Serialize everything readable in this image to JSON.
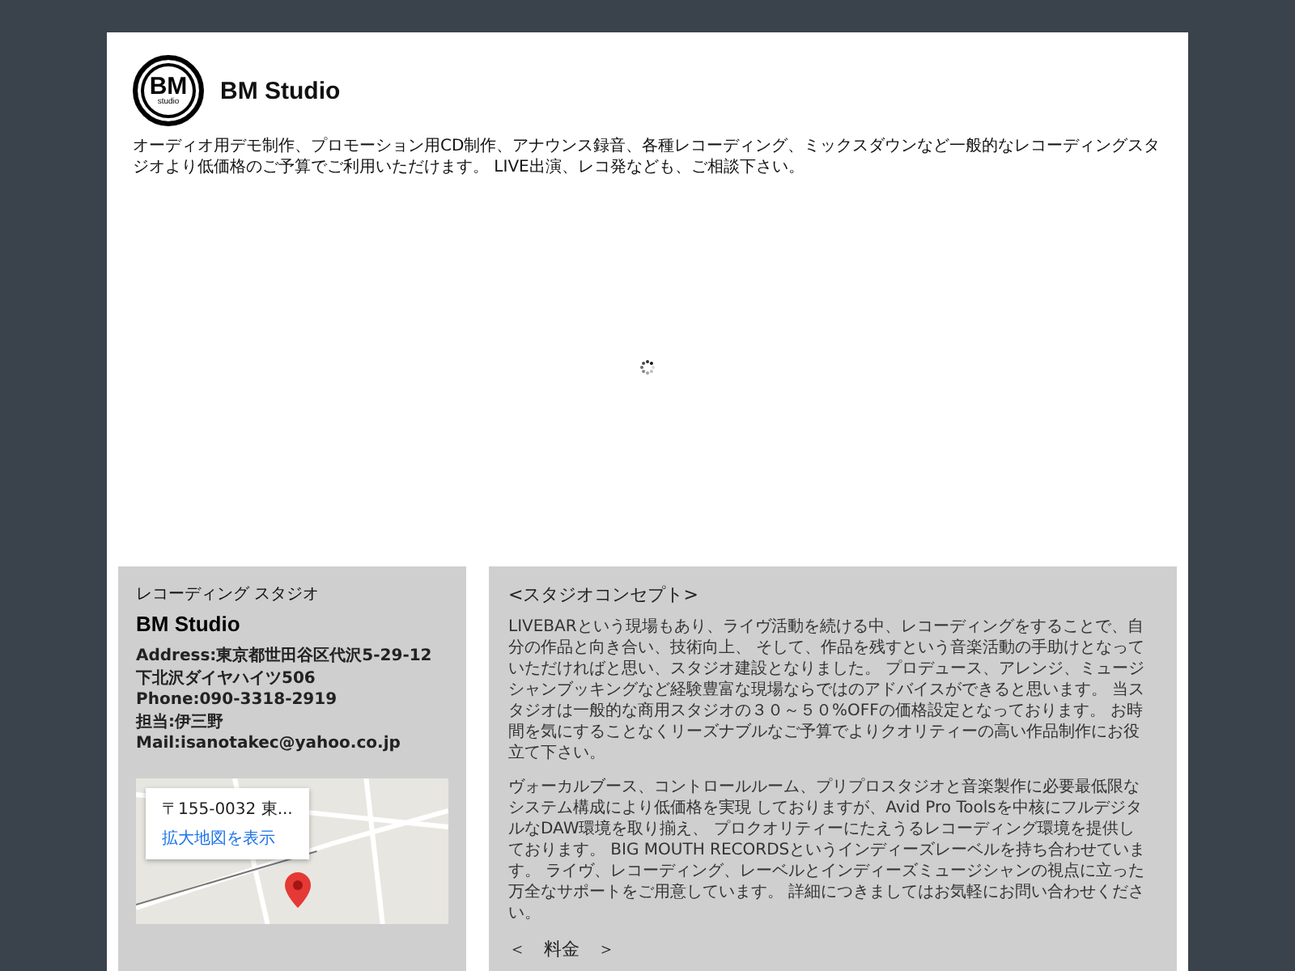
{
  "header": {
    "logo": {
      "main": "BM",
      "sub": "studio"
    },
    "title": "BM Studio",
    "description": "オーディオ用デモ制作、プロモーション用CD制作、アナウンス録音、各種レコーディング、ミックスダウンなど一般的なレコーディングスタジオより低価格のご予算でご利用いただけます。 LIVE出演、レコ発なども、ご相談下さい。"
  },
  "content": {
    "loading": true
  },
  "info_card": {
    "label": "レコーディング スタジオ",
    "name": "BM Studio",
    "lines": [
      "Address:東京都世田谷区代沢5-29-12",
      "下北沢ダイヤハイツ506",
      "Phone:090-3318-2919",
      "担当:伊三野",
      "Mail:isanotakec@yahoo.co.jp"
    ],
    "map": {
      "address": "〒155-0032 東...",
      "link": "拡大地図を表示"
    }
  },
  "concept_card": {
    "heading": "<スタジオコンセプト>",
    "paragraphs": [
      "LIVEBARという現場もあり、ライヴ活動を続ける中、レコーディングをすることで、自分の作品と向き合い、技術向上、 そして、作品を残すという音楽活動の手助けとなっていただければと思い、スタジオ建設となりました。 プロデュース、アレンジ、ミュージシャンブッキングなど経験豊富な現場ならではのアドバイスができると思います。 当スタジオは一般的な商用スタジオの３０～５０%OFFの価格設定となっております。 お時間を気にすることなくリーズナブルなご予算でよりクオリティーの高い作品制作にお役立て下さい。",
      "ヴォーカルブース、コントロールルーム、プリプロスタジオと音楽製作に必要最低限なシステム構成により低価格を実現 しておりますが、Avid Pro Toolsを中核にフルデジタルなDAW環境を取り揃え、 プロクオリティーにたえうるレコーディング環境を提供しております。 BIG MOUTH RECORDSというインディーズレーベルを持ち合わせています。 ライヴ、レコーディング、レーベルとインディーズミュージシャンの視点に立った万全なサポートをご用意しています。 詳細につきましてはお気軽にお問い合わせください。"
    ],
    "next_heading": "＜　料金　＞"
  }
}
